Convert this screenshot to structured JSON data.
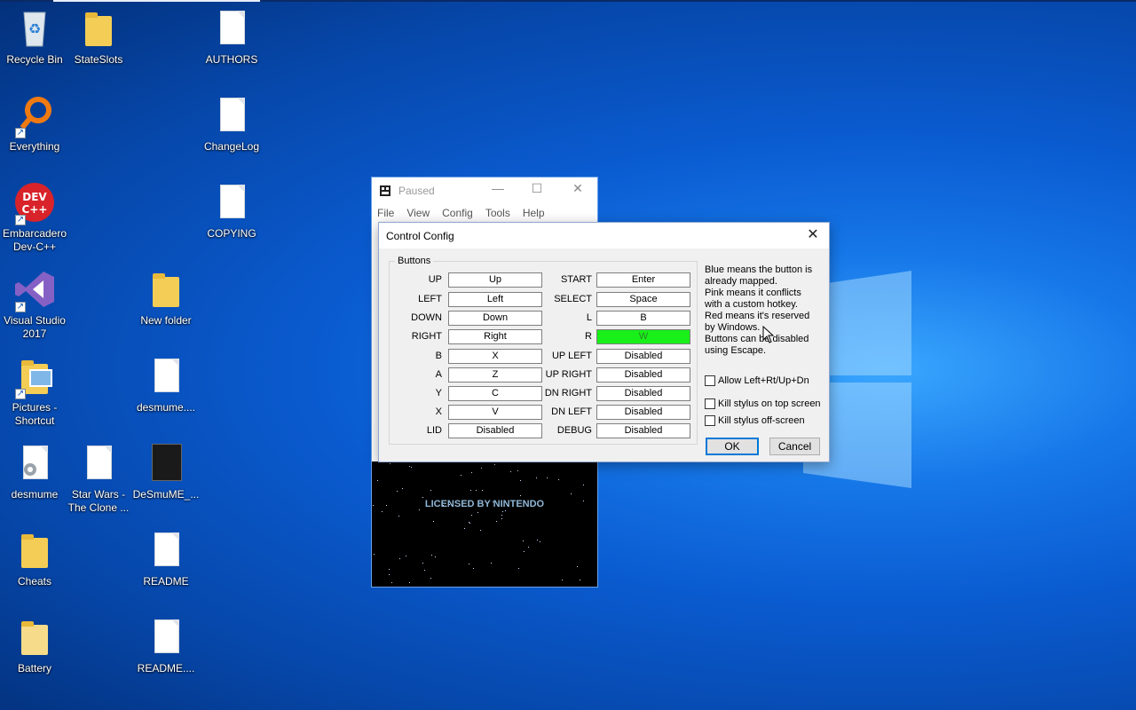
{
  "desktop": {
    "icons": [
      {
        "label": "Recycle Bin"
      },
      {
        "label": "StateSlots"
      },
      {
        "label": "AUTHORS"
      },
      {
        "label": "Everything"
      },
      {
        "label": "ChangeLog"
      },
      {
        "label": "Embarcadero Dev-C++"
      },
      {
        "label": "COPYING"
      },
      {
        "label": "Visual Studio 2017"
      },
      {
        "label": "New folder"
      },
      {
        "label": "Pictures - Shortcut"
      },
      {
        "label": "desmume...."
      },
      {
        "label": "desmume"
      },
      {
        "label": "Star Wars - The Clone ..."
      },
      {
        "label": "DeSmuME_..."
      },
      {
        "label": "Cheats"
      },
      {
        "label": "README"
      },
      {
        "label": "Battery"
      },
      {
        "label": "README...."
      }
    ]
  },
  "emulator": {
    "title": "Paused",
    "menu": [
      "File",
      "View",
      "Config",
      "Tools",
      "Help"
    ],
    "splash": "LICENSED BY NINTENDO"
  },
  "dialog": {
    "title": "Control Config",
    "group_title": "Buttons",
    "left_column": [
      {
        "label": "UP",
        "value": "Up"
      },
      {
        "label": "LEFT",
        "value": "Left"
      },
      {
        "label": "DOWN",
        "value": "Down"
      },
      {
        "label": "RIGHT",
        "value": "Right"
      },
      {
        "label": "B",
        "value": "X"
      },
      {
        "label": "A",
        "value": "Z"
      },
      {
        "label": "Y",
        "value": "C"
      },
      {
        "label": "X",
        "value": "V"
      },
      {
        "label": "LID",
        "value": "Disabled"
      }
    ],
    "right_column": [
      {
        "label": "START",
        "value": "Enter"
      },
      {
        "label": "SELECT",
        "value": "Space"
      },
      {
        "label": "L",
        "value": "B"
      },
      {
        "label": "R",
        "value": "W"
      },
      {
        "label": "UP LEFT",
        "value": "Disabled"
      },
      {
        "label": "UP RIGHT",
        "value": "Disabled"
      },
      {
        "label": "DN RIGHT",
        "value": "Disabled"
      },
      {
        "label": "DN LEFT",
        "value": "Disabled"
      },
      {
        "label": "DEBUG",
        "value": "Disabled"
      }
    ],
    "help_lines": [
      "Blue means the button is",
      "already mapped.",
      "Pink means it conflicts",
      "with a custom hotkey.",
      "Red means it's reserved",
      "by Windows.",
      "Buttons can be disabled",
      "using Escape."
    ],
    "checkboxes": [
      {
        "label": "Allow Left+Rt/Up+Dn",
        "checked": false
      },
      {
        "label": "Kill stylus on top screen",
        "checked": false
      },
      {
        "label": "Kill stylus off-screen",
        "checked": false
      }
    ],
    "ok_label": "OK",
    "cancel_label": "Cancel"
  },
  "colors": {
    "active_binding": "#19ef19",
    "accent": "#0078d7"
  }
}
